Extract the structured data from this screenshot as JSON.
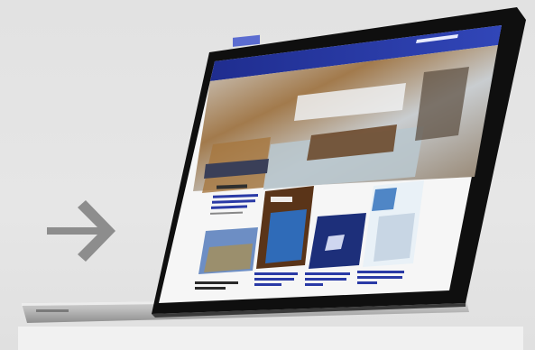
{
  "scene": {
    "background_color": "#e4e4e4",
    "arrow_color": "#8a8a8a",
    "bezel_color": "#111111"
  },
  "website": {
    "header_color": "#2a3aa6",
    "logo_text": "",
    "hero_caption": "",
    "section_title": "",
    "articles": [
      {
        "caption": ""
      },
      {
        "caption": ""
      },
      {
        "caption": ""
      },
      {
        "caption": ""
      }
    ]
  }
}
